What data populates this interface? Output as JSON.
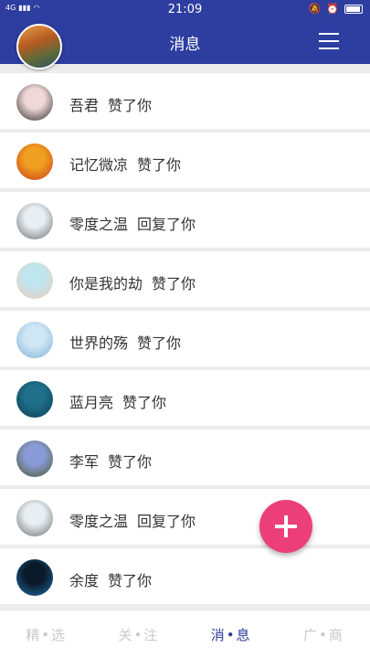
{
  "status_bar": {
    "network": "4G",
    "time": "21:09"
  },
  "app_bar": {
    "title": "消息"
  },
  "messages": [
    {
      "name": "吾君",
      "action": "赞了你",
      "avatar_colors": [
        "#f0d8d8",
        "#2a2a2a"
      ]
    },
    {
      "name": "记忆微凉",
      "action": "赞了你",
      "avatar_colors": [
        "#f0a020",
        "#c83a1a"
      ]
    },
    {
      "name": "零度之温",
      "action": "回复了你",
      "avatar_colors": [
        "#e8eef2",
        "#6a6e72"
      ]
    },
    {
      "name": "你是我的劫",
      "action": "赞了你",
      "avatar_colors": [
        "#bfe6ee",
        "#f1c9b6"
      ]
    },
    {
      "name": "世界的殇",
      "action": "赞了你",
      "avatar_colors": [
        "#cfe6f4",
        "#7fb2d6"
      ]
    },
    {
      "name": "蓝月亮",
      "action": "赞了你",
      "avatar_colors": [
        "#1f6f8a",
        "#0d3b52"
      ]
    },
    {
      "name": "李军",
      "action": "赞了你",
      "avatar_colors": [
        "#8a9ad8",
        "#4a5a2a"
      ]
    },
    {
      "name": "零度之温",
      "action": "回复了你",
      "avatar_colors": [
        "#e8eef2",
        "#6a6e72"
      ]
    },
    {
      "name": "余度",
      "action": "赞了你",
      "avatar_colors": [
        "#0a1a2a",
        "#1d6fa8"
      ]
    }
  ],
  "bottom_nav": [
    {
      "label": "精•选",
      "active": false
    },
    {
      "label": "关•注",
      "active": false
    },
    {
      "label": "消•息",
      "active": true
    },
    {
      "label": "广•商",
      "active": false
    }
  ],
  "colors": {
    "primary": "#2d3da0",
    "fab": "#ec3f7a"
  },
  "icons": [
    "wifi-icon",
    "alarm-icon",
    "mute-icon",
    "battery-icon",
    "menu-icon",
    "add-icon"
  ]
}
